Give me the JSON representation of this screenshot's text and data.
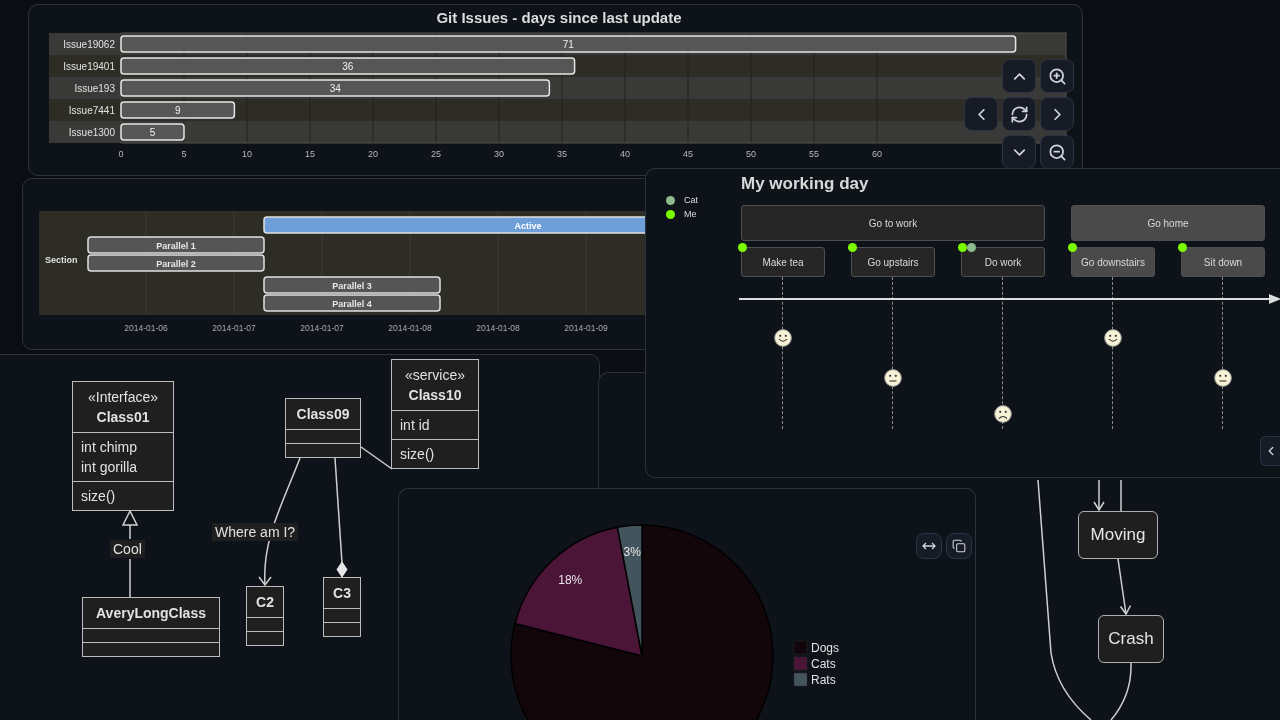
{
  "bar_chart_panel": {
    "chart_data": {
      "type": "bar",
      "orientation": "horizontal",
      "title": "Git Issues - days since last update",
      "categories": [
        "Issue19062",
        "Issue19401",
        "Issue193",
        "Issue7441",
        "Issue1300"
      ],
      "values": [
        71,
        36,
        34,
        9,
        5
      ],
      "xlim": [
        0,
        75
      ],
      "xticks": [
        0,
        5,
        10,
        15,
        20,
        25,
        30,
        35,
        40,
        45,
        50,
        55,
        60
      ],
      "grid": true,
      "data_labels": true
    }
  },
  "gantt_panel": {
    "section": "Section",
    "tasks": [
      {
        "label": "Active",
        "kind": "active"
      },
      {
        "label": "Parallel 1",
        "kind": "task"
      },
      {
        "label": "Parallel 2",
        "kind": "task"
      },
      {
        "label": "Parallel 3",
        "kind": "task"
      },
      {
        "label": "Parallel 4",
        "kind": "task"
      }
    ],
    "axis_labels": [
      "2014-01-06",
      "2014-01-07",
      "2014-01-07",
      "2014-01-08",
      "2014-01-08",
      "2014-01-09"
    ]
  },
  "journey_panel": {
    "title": "My working day",
    "legend": [
      {
        "label": "Cat",
        "color": "#8fbc8f"
      },
      {
        "label": "Me",
        "color": "#7cfc00"
      }
    ],
    "sections": [
      {
        "label": "Go to work",
        "color": "#262626",
        "tasks": [
          {
            "label": "Make tea",
            "kind": "happy",
            "dots": [
              {
                "color": "#7cfc00"
              }
            ]
          },
          {
            "label": "Go upstairs",
            "kind": "neutral",
            "dots": [
              {
                "color": "#7cfc00"
              }
            ]
          },
          {
            "label": "Do work",
            "kind": "sad",
            "dots": [
              {
                "color": "#7cfc00"
              },
              {
                "color": "#8fbc8f"
              }
            ]
          }
        ]
      },
      {
        "label": "Go home",
        "color": "#4a4a4a",
        "tasks": [
          {
            "label": "Go downstairs",
            "kind": "happy",
            "dots": [
              {
                "color": "#7cfc00"
              }
            ]
          },
          {
            "label": "Sit down",
            "kind": "neutral",
            "dots": [
              {
                "color": "#7cfc00"
              }
            ]
          }
        ]
      }
    ]
  },
  "class_diagram": {
    "classes": [
      {
        "stereotype": "«Interface»",
        "name": "Class01",
        "attributes": [
          "int chimp",
          "int gorilla"
        ],
        "methods": [
          "size()"
        ]
      },
      {
        "name": "Class09"
      },
      {
        "stereotype": "«service»",
        "name": "Class10",
        "attributes": [
          "int id"
        ],
        "methods": [
          "size()"
        ]
      },
      {
        "name": "AveryLongClass"
      },
      {
        "name": "C2"
      },
      {
        "name": "C3"
      }
    ],
    "relations": [
      {
        "kind": "inheritance",
        "label": "Cool"
      },
      {
        "kind": "association",
        "label": "Where am I?"
      },
      {
        "kind": "composition"
      },
      {
        "kind": "link"
      }
    ]
  },
  "pie_panel": {
    "chart_data": {
      "type": "pie",
      "categories": [
        "Dogs",
        "Cats",
        "Rats"
      ],
      "values": [
        79,
        18,
        3
      ],
      "colors": [
        "#12060a",
        "#4b1538",
        "#44545c"
      ],
      "value_labels": [
        null,
        "18%",
        "3%"
      ],
      "legend": "right"
    }
  },
  "state_diagram": {
    "states": [
      "Moving",
      "Crash"
    ]
  }
}
